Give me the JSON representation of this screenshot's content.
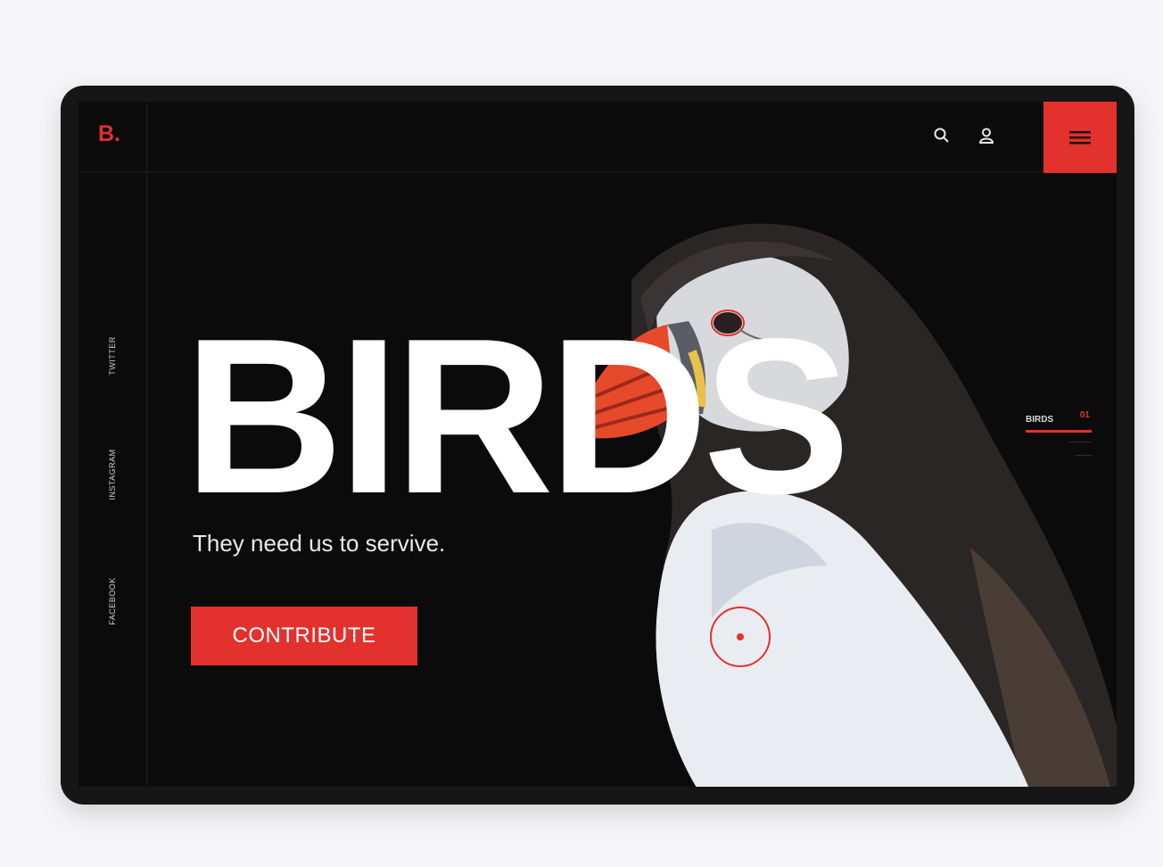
{
  "brand": {
    "logo": "B."
  },
  "social": [
    {
      "label": "TWITTER"
    },
    {
      "label": "INSTAGRAM"
    },
    {
      "label": "FACEBOOK"
    }
  ],
  "header": {
    "icons": [
      "search-icon",
      "user-icon",
      "menu-icon"
    ]
  },
  "hero": {
    "title": "BIRDS",
    "tagline": "They need us to servive.",
    "cta_label": "CONTRIBUTE"
  },
  "side_nav": {
    "label": "BIRDS",
    "number": "01"
  },
  "colors": {
    "accent": "#e3312e",
    "background": "#0c0b0b",
    "text": "#ffffff"
  }
}
